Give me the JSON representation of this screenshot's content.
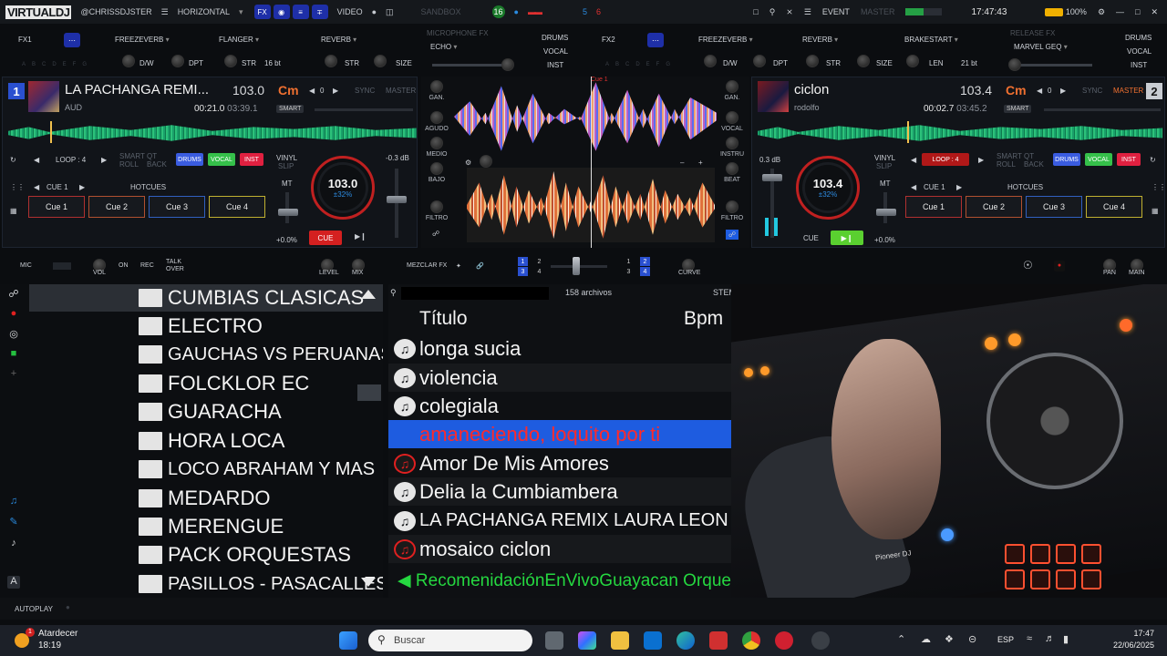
{
  "topbar": {
    "logo": "VIRTUALDJ",
    "user": "@CHRISSDJSTER",
    "layout": "HORIZONTAL",
    "fx_label": "FX",
    "video_label": "VIDEO",
    "sandbox": "SANDBOX",
    "badge_left": "16",
    "badge_a": "5",
    "badge_b": "6",
    "event": "EVENT",
    "master": "MASTER",
    "clock": "17:47:43",
    "battery": "100%"
  },
  "fx": {
    "left": {
      "unit": "FX1",
      "slot1": "FREEZEVERB",
      "slot2": "FLANGER",
      "slot3": "REVERB",
      "p1": "D/W",
      "p2": "DPT",
      "p3": "STR",
      "p4": "16 bt",
      "p5": "STR",
      "p6": "SIZE"
    },
    "mic_fx": "MICROPHONE FX",
    "mic_effect": "ECHO",
    "stems_left": [
      "DRUMS",
      "VOCAL",
      "INST"
    ],
    "right": {
      "unit": "FX2",
      "slot1": "FREEZEVERB",
      "slot2": "REVERB",
      "slot3": "BRAKESTART",
      "p1": "D/W",
      "p2": "DPT",
      "p3": "STR",
      "p4": "SIZE",
      "p5": "LEN",
      "p6": "21 bt"
    },
    "release_fx": "RELEASE FX",
    "release_effect": "MARVEL GEQ",
    "stems_right": [
      "DRUMS",
      "VOCAL",
      "INST"
    ]
  },
  "deck1": {
    "number": "1",
    "title": "LA PACHANGA REMI...",
    "artist": "AUD",
    "bpm": "103.0",
    "key": "Cm",
    "pitch_step": "0",
    "sync": "SYNC",
    "master": "MASTER",
    "elapsed": "00:21.0",
    "remain": "03:39.1",
    "smart": "SMART",
    "loop": "LOOP : 4",
    "smart_roll": "SMART\nROLL",
    "qt_back": "QT\nBACK",
    "stem_buttons": [
      "DRUMS",
      "VOCAL",
      "INST"
    ],
    "cue_select": "CUE 1",
    "hotcues": "HOTCUES",
    "cues": [
      "Cue 1",
      "Cue 2",
      "Cue 3",
      "Cue 4"
    ],
    "jog_bpm": "103.0",
    "jog_pitch": "±32%",
    "vinyl": "VINYL",
    "slip": "SLIP",
    "mt": "MT",
    "gain_db": "-0.3 dB",
    "pitch_pct": "+0.0%",
    "cue_btn": "CUE",
    "play_btn": "▶❙"
  },
  "deck2": {
    "number": "2",
    "title": "ciclon",
    "artist": "rodolfo",
    "bpm": "103.4",
    "key": "Cm",
    "pitch_step": "0",
    "sync": "SYNC",
    "master": "MASTER",
    "elapsed": "00:02.7",
    "remain": "03:45.2",
    "smart": "SMART",
    "loop": "LOOP : 4",
    "stem_buttons": [
      "DRUMS",
      "VOCAL",
      "INST"
    ],
    "cue_select": "CUE 1",
    "hotcues": "HOTCUES",
    "cues": [
      "Cue 1",
      "Cue 2",
      "Cue 3",
      "Cue 4"
    ],
    "jog_bpm": "103.4",
    "jog_pitch": "±32%",
    "vinyl": "VINYL",
    "slip": "SLIP",
    "mt": "MT",
    "gain_db": "0.3 dB",
    "pitch_pct": "+0.0%",
    "cue_btn": "CUE",
    "play_btn": "▶❙"
  },
  "center": {
    "cue_marker": "Cue 1",
    "eq_left": [
      "GAN.",
      "AGUDO",
      "MEDIO",
      "BAJO",
      "FILTRO"
    ],
    "eq_right": [
      "GAN.",
      "VOCAL",
      "INSTRU",
      "BEAT",
      "FILTRO"
    ]
  },
  "mixbar": {
    "mic": "MIC",
    "vol": "VOL",
    "on": "ON",
    "rec": "REC",
    "talkover": "TALK OVER",
    "level": "LEVEL",
    "mix": "MIX",
    "mezclar_fx": "MEZCLAR FX",
    "curve": "CURVE",
    "pan": "PAN",
    "main": "MAIN",
    "deck_nums_left": [
      "1",
      "2",
      "3",
      "4"
    ],
    "deck_nums_right": [
      "1",
      "2",
      "3",
      "4"
    ]
  },
  "browser": {
    "folders": [
      "CUMBIAS CLASICAS",
      "ELECTRO",
      "GAUCHAS VS PERUANAS",
      "FOLCKLOR EC",
      "GUARACHA",
      "HORA LOCA",
      "LOCO ABRAHAM Y MAS",
      "MEDARDO",
      "MERENGUE",
      "PACK ORQUESTAS",
      "PASILLOS - PASACALLES"
    ],
    "vertical_tab": "folders",
    "file_count": "158 archivos",
    "stems_label": "STEMS",
    "col_title": "Título",
    "col_bpm": "Bpm",
    "tracks": [
      {
        "title": "longa sucia",
        "icon": "note"
      },
      {
        "title": "violencia",
        "icon": "note"
      },
      {
        "title": "colegiala",
        "icon": "note"
      },
      {
        "title": "amaneciendo, loquito por ti",
        "icon": "note"
      },
      {
        "title": "Amor De Mis Amores",
        "icon": "note-red"
      },
      {
        "title": "Delia la Cumbiambera",
        "icon": "note"
      },
      {
        "title": "LA PACHANGA REMIX LAURA LEON",
        "icon": "note"
      },
      {
        "title": "mosaico ciclon",
        "icon": "note-red"
      }
    ],
    "recommendation": "RecomenidaciónEnVivoGuayacan Orquesta"
  },
  "camera": {
    "brand": "Pioneer DJ"
  },
  "autoplay": "AUTOPLAY",
  "taskbar": {
    "weather_title": "Atardecer",
    "weather_time": "18:19",
    "notif": "1",
    "search_placeholder": "Buscar",
    "lang": "ESP",
    "time": "17:47",
    "date": "22/06/2025"
  },
  "colors": {
    "accent_blue": "#2a50d0",
    "key_orange": "#f07030",
    "cue_red": "#d42020",
    "select_blue": "#1e5ce0",
    "reco_green": "#25d840"
  }
}
